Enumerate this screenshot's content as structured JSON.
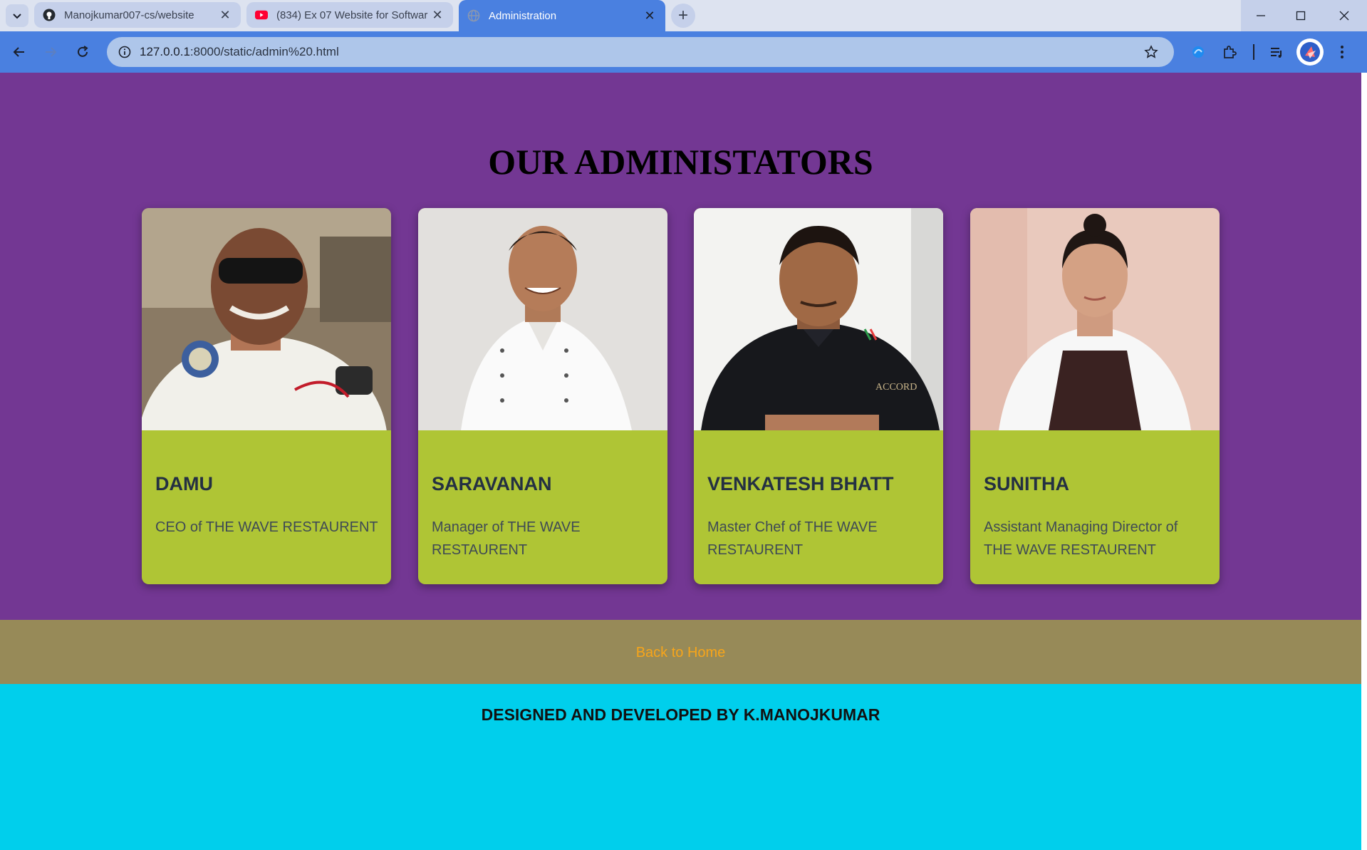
{
  "browser": {
    "tabs": [
      {
        "title": "Manojkumar007-cs/website",
        "favicon": "github-icon",
        "active": false
      },
      {
        "title": "(834) Ex 07 Website for Softwar",
        "favicon": "youtube-icon",
        "active": false
      },
      {
        "title": "Administration",
        "favicon": "globe-icon",
        "active": true
      }
    ],
    "url_host": "127.0.0.1",
    "url_rest": ":8000/static/admin%20.html",
    "accent_color": "#4a80e0"
  },
  "page": {
    "title": "OUR ADMINISTATORS",
    "admins": [
      {
        "name": "DAMU",
        "role": "CEO of THE WAVE RESTAURENT"
      },
      {
        "name": "SARAVANAN",
        "role": "Manager of THE WAVE RESTAURENT"
      },
      {
        "name": "VENKATESH BHATT",
        "role": "Master Chef of THE WAVE RESTAURENT"
      },
      {
        "name": "SUNITHA",
        "role": "Assistant Managing Director of THE WAVE RESTAURENT"
      }
    ],
    "back_link": "Back to Home",
    "footer": "DESIGNED AND DEVELOPED BY K.MANOJKUMAR",
    "colors": {
      "section_bg": "#733793",
      "card_bg": "#afc535",
      "backbar_bg": "#978a58",
      "link": "#f7a51a",
      "footer_bg": "#00cfec"
    }
  }
}
